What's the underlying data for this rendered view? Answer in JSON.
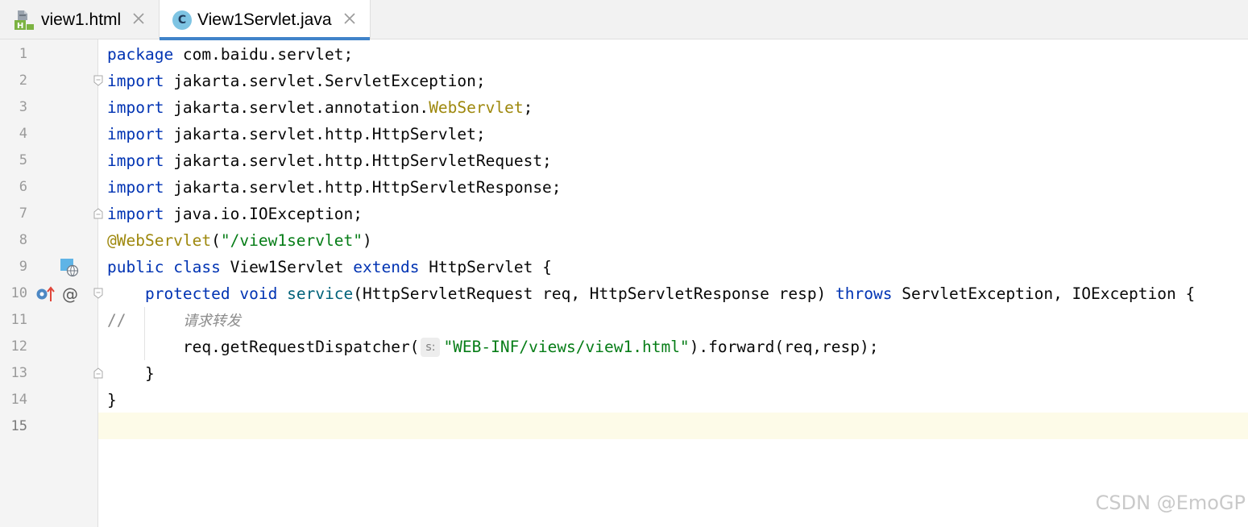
{
  "tabs": [
    {
      "label": "view1.html",
      "icon": "html-file-icon",
      "active": false
    },
    {
      "label": "View1Servlet.java",
      "icon": "java-class-icon",
      "active": true
    }
  ],
  "gutter": {
    "line_numbers": [
      "1",
      "2",
      "3",
      "4",
      "5",
      "6",
      "7",
      "8",
      "9",
      "10",
      "11",
      "12",
      "13",
      "14",
      "15"
    ],
    "current_line": "15"
  },
  "code": {
    "l1": {
      "kw": "package",
      "rest": " com.baidu.servlet;"
    },
    "l2": {
      "kw": "import",
      "rest": " jakarta.servlet.ServletException;"
    },
    "l3": {
      "kw": "import",
      "mid": " jakarta.servlet.annotation.",
      "ann": "WebServlet",
      "end": ";"
    },
    "l4": {
      "kw": "import",
      "rest": " jakarta.servlet.http.HttpServlet;"
    },
    "l5": {
      "kw": "import",
      "rest": " jakarta.servlet.http.HttpServletRequest;"
    },
    "l6": {
      "kw": "import",
      "rest": " jakarta.servlet.http.HttpServletResponse;"
    },
    "l7": {
      "kw": "import",
      "rest": " java.io.IOException;"
    },
    "l8": {
      "ann": "@WebServlet",
      "open": "(",
      "str": "\"/view1servlet\"",
      "close": ")"
    },
    "l9": {
      "kw1": "public",
      "kw2": "class",
      "name": " View1Servlet ",
      "kw3": "extends",
      "rest": " HttpServlet {"
    },
    "l10": {
      "indent": "    ",
      "kw1": "protected",
      "kw2": "void",
      "method": "service",
      "params": "(HttpServletRequest req, HttpServletResponse resp) ",
      "kw3": "throws",
      "rest": " ServletException, IOException {"
    },
    "l11": {
      "comment": "//",
      "comment_text": "请求转发"
    },
    "l12": {
      "indent": "        ",
      "call": "req.getRequestDispatcher(",
      "hint": "s:",
      "str": "\"WEB-INF/views/view1.html\"",
      "rest": ").forward(req,resp);"
    },
    "l13": {
      "text": "    }"
    },
    "l14": {
      "text": "}"
    }
  },
  "watermark": "CSDN @EmoGP",
  "colors": {
    "keyword": "#0033b3",
    "annotation": "#9e880d",
    "string": "#067d17",
    "method": "#00627a",
    "comment": "#8c8c8c",
    "tab_accent": "#4083c9",
    "current_line": "#fdfbe8"
  }
}
